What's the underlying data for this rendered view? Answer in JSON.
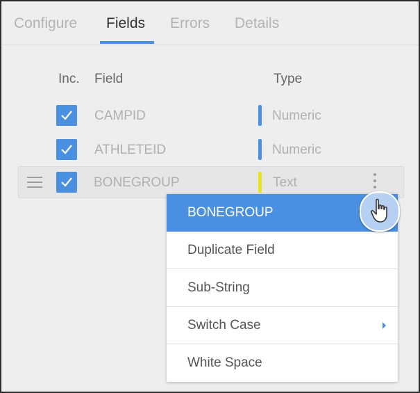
{
  "tabs": [
    {
      "label": "Configure",
      "active": false
    },
    {
      "label": "Fields",
      "active": true
    },
    {
      "label": "Errors",
      "active": false
    },
    {
      "label": "Details",
      "active": false
    }
  ],
  "table": {
    "headers": {
      "include": "Inc.",
      "field": "Field",
      "type": "Type"
    },
    "rows": [
      {
        "field": "CAMPID",
        "type": "Numeric",
        "included": true,
        "type_color": "#4a90e2"
      },
      {
        "field": "ATHLETEID",
        "type": "Numeric",
        "included": true,
        "type_color": "#4a90e2"
      },
      {
        "field": "BONEGROUP",
        "type": "Text",
        "included": true,
        "type_color": "#e8e21c",
        "selected": true
      }
    ]
  },
  "context_menu": {
    "title": "BONEGROUP",
    "items": [
      {
        "label": "Duplicate Field",
        "has_submenu": false
      },
      {
        "label": "Sub-String",
        "has_submenu": false
      },
      {
        "label": "Switch Case",
        "has_submenu": true
      },
      {
        "label": "White Space",
        "has_submenu": false
      }
    ]
  },
  "colors": {
    "accent": "#4a90e2",
    "numeric_type": "#4a90e2",
    "text_type": "#e8e21c",
    "background": "#eeeeee"
  },
  "icons": [
    "drag-handle-icon",
    "checkmark-icon",
    "kebab-menu-icon",
    "chevron-right-icon",
    "hand-pointer-icon"
  ]
}
